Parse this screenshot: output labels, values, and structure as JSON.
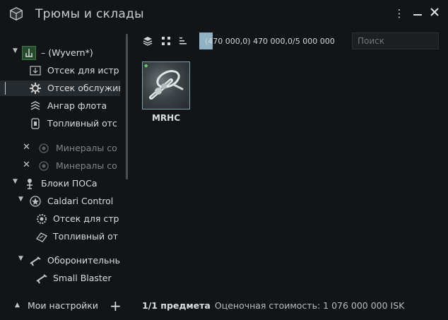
{
  "window": {
    "title": "Трюмы и склады",
    "controls": {
      "menu_icon": "kebab-icon",
      "minimize_icon": "minimize-icon",
      "close_icon": "close-icon"
    }
  },
  "sidebar": {
    "items": [
      {
        "label": "– (Wyvern*)",
        "icon": "ship-icon"
      },
      {
        "label": "Отсек для истр",
        "icon": "fighter-bay-icon"
      },
      {
        "label": "Отсек обслужив",
        "icon": "gear-icon"
      },
      {
        "label": "Ангар флота",
        "icon": "fleet-hangar-icon"
      },
      {
        "label": "Топливный отс",
        "icon": "fuel-bay-icon"
      },
      {
        "label": "Минералы со",
        "icon": "mineral-icon"
      },
      {
        "label": "Минералы со",
        "icon": "mineral-icon"
      },
      {
        "label": "Блоки ПОСа",
        "icon": "pos-icon"
      },
      {
        "label": "Caldari Control",
        "icon": "control-tower-icon"
      },
      {
        "label": "Отсек для стр",
        "icon": "structure-bay-icon"
      },
      {
        "label": "Топливный от",
        "icon": "fuel-bay-icon"
      },
      {
        "label": "Оборонительны",
        "icon": "weapon-icon"
      },
      {
        "label": "Small Blaster",
        "icon": "blaster-icon"
      }
    ],
    "footer": {
      "label": "Мои настройки"
    }
  },
  "toolbar": {
    "capacity_text": "(470 000,0) 470 000,0/5 000 000",
    "capacity_fill": 0.094,
    "search_placeholder": "Поиск"
  },
  "items": [
    {
      "label": "MRHC",
      "icon": "mobile-tractor-icon"
    }
  ],
  "status": {
    "count": "1/1 предмета",
    "estimate": "Оценочная стоимость: 1 076 000 000 ISK"
  },
  "colors": {
    "background": "#121517",
    "accent": "#8fb3c3",
    "selected_row": "#252b2f"
  }
}
